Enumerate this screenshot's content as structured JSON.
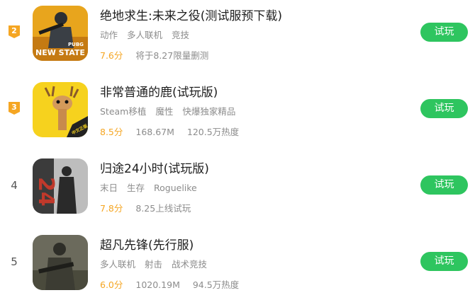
{
  "games": [
    {
      "rank": "2",
      "title": "绝地求生:未来之役(测试服预下载)",
      "tags": [
        "动作",
        "多人联机",
        "竞技"
      ],
      "score": "7.6分",
      "meta": [
        "将于8.27限量删测"
      ],
      "button": "试玩",
      "thumb_text": [
        "PUBG",
        "NEW STATE"
      ]
    },
    {
      "rank": "3",
      "title": "非常普通的鹿(试玩版)",
      "tags": [
        "Steam移植",
        "魔性",
        "快爆独家精品"
      ],
      "score": "8.5分",
      "meta": [
        "168.67M",
        "120.5万热度"
      ],
      "button": "试玩",
      "thumb_text": [
        "中文正版"
      ]
    },
    {
      "rank": "4",
      "title": "归途24小时(试玩版)",
      "tags": [
        "末日",
        "生存",
        "Roguelike"
      ],
      "score": "7.8分",
      "meta": [
        "8.25上线试玩"
      ],
      "button": "试玩",
      "thumb_text": [
        "24"
      ]
    },
    {
      "rank": "5",
      "title": "超凡先锋(先行服)",
      "tags": [
        "多人联机",
        "射击",
        "战术竞技"
      ],
      "score": "6.0分",
      "meta": [
        "1020.19M",
        "94.5万热度"
      ],
      "button": "试玩",
      "thumb_text": []
    }
  ],
  "colors": {
    "accent_green": "#2ec55f",
    "score_orange": "#f5a623",
    "rank_badge": "#f5a623"
  }
}
